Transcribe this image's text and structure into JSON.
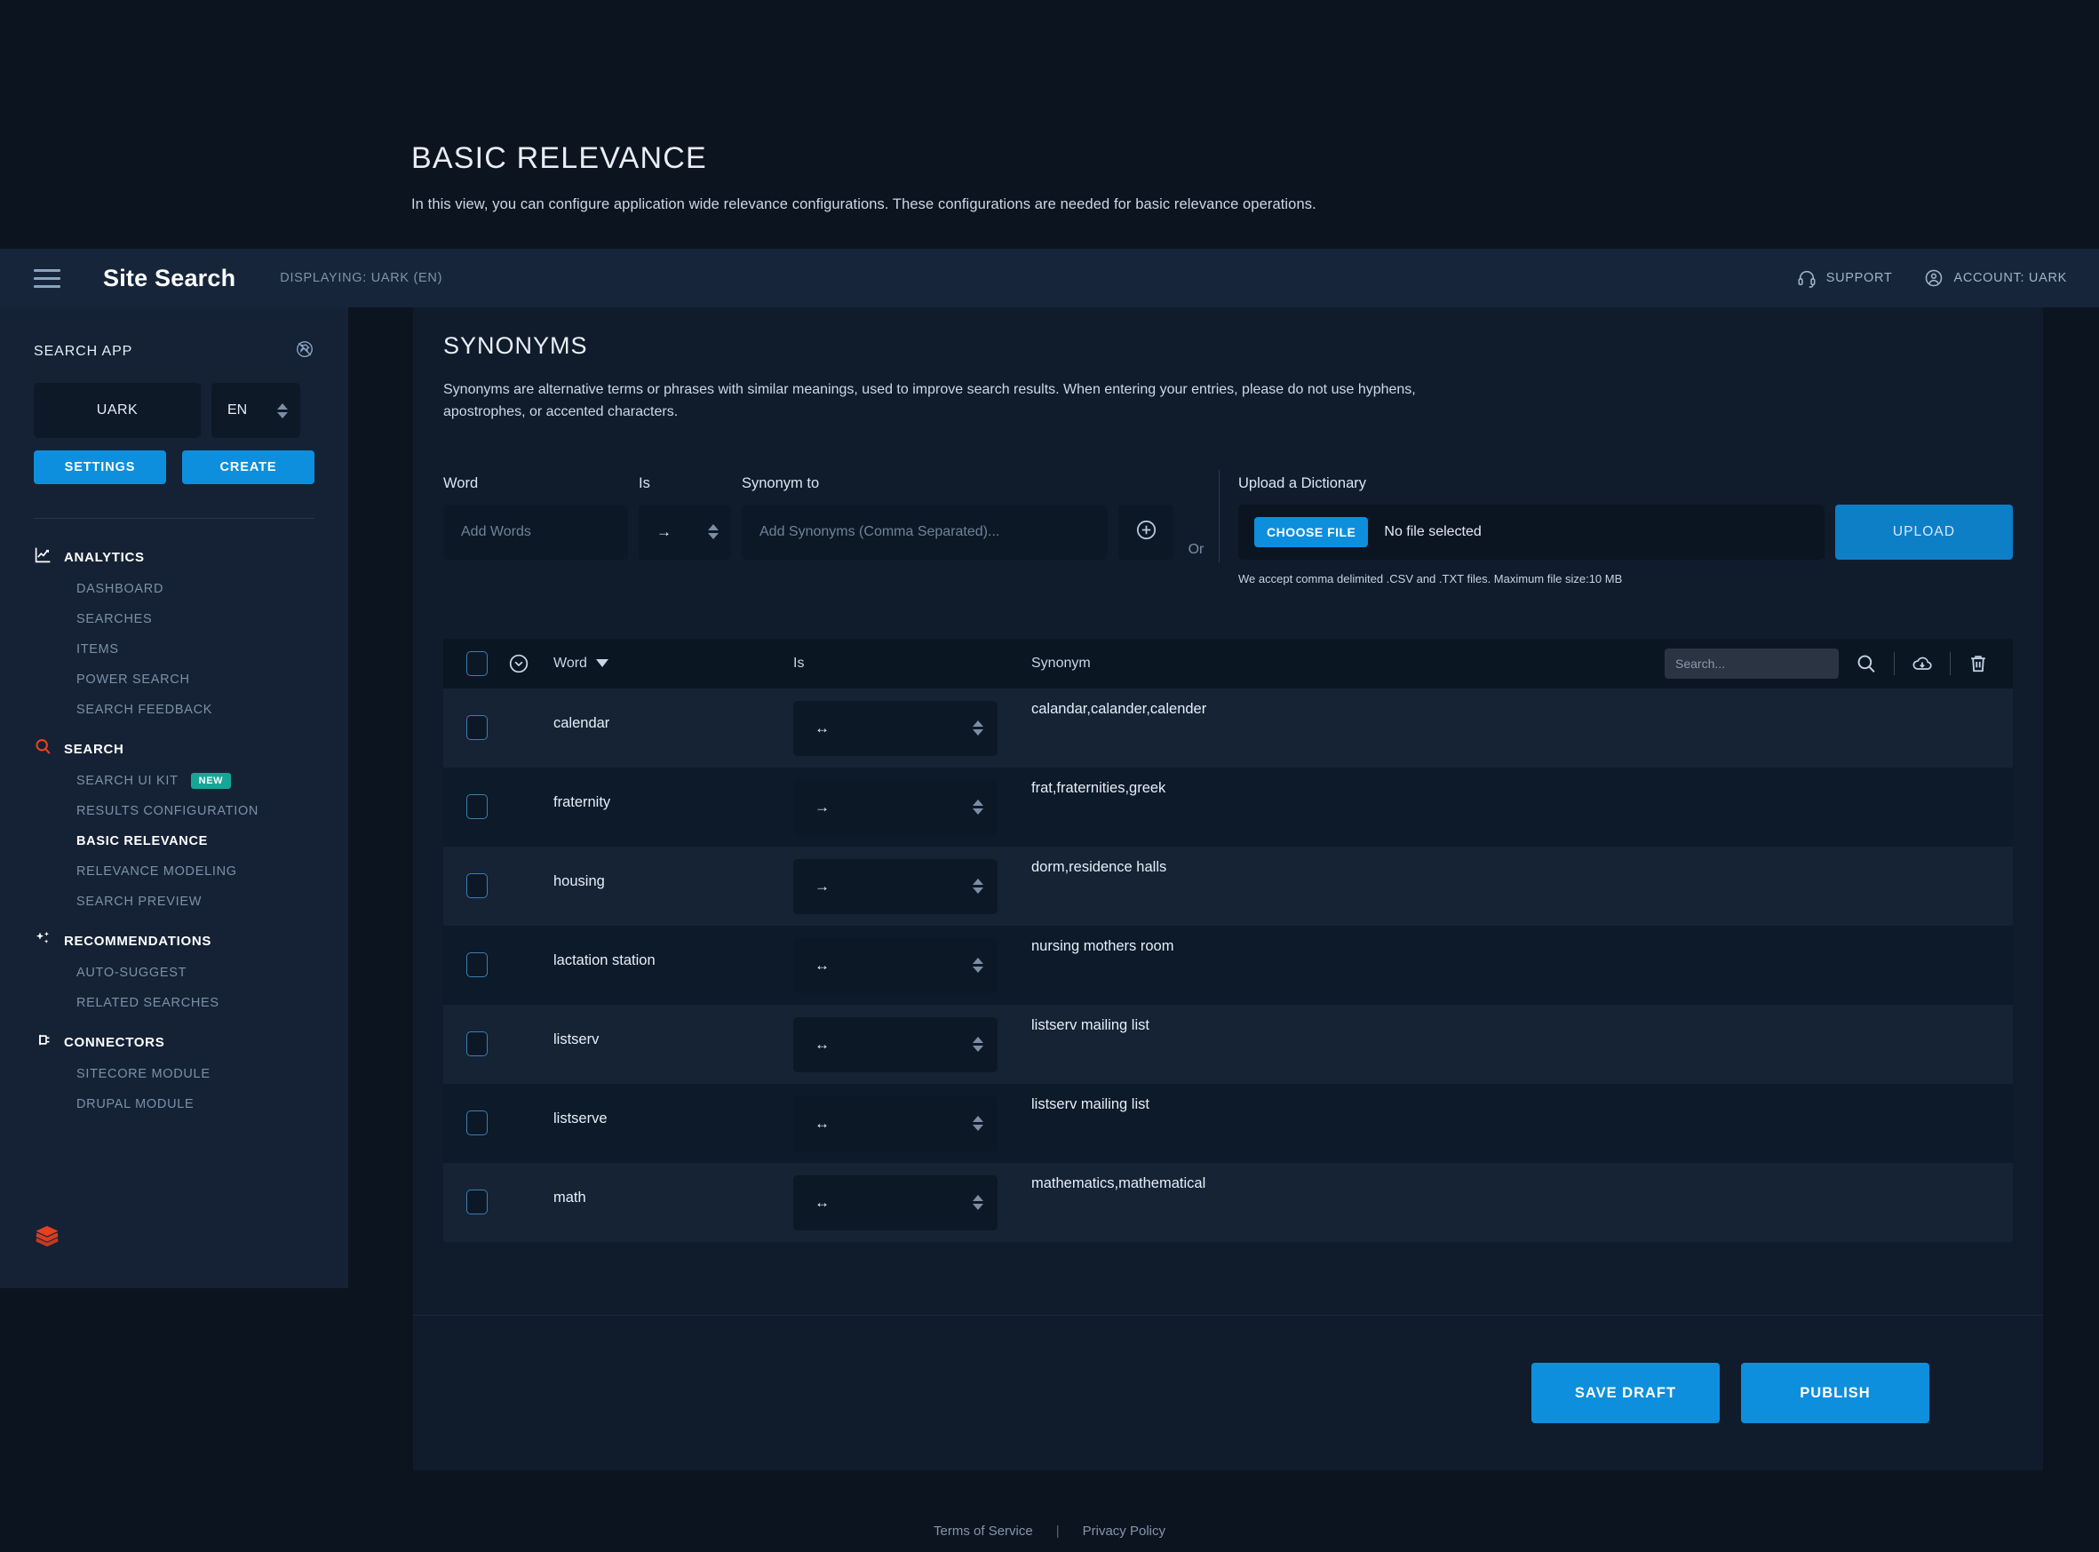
{
  "intro": {
    "title": "BASIC RELEVANCE",
    "description": "In this view, you can configure application wide relevance configurations. These configurations are needed for basic relevance operations."
  },
  "topbar": {
    "brand": "Site Search",
    "displaying": "DISPLAYING: UARK (EN)",
    "support_label": "SUPPORT",
    "account_label": "ACCOUNT: UARK"
  },
  "sidebar": {
    "section_title": "SEARCH APP",
    "app_value": "UARK",
    "lang_value": "EN",
    "settings_label": "SETTINGS",
    "create_label": "CREATE",
    "groups": [
      {
        "label": "ANALYTICS",
        "icon": "chart-line-icon",
        "items": [
          {
            "label": "DASHBOARD",
            "active": false,
            "badge": ""
          },
          {
            "label": "SEARCHES",
            "active": false,
            "badge": ""
          },
          {
            "label": "ITEMS",
            "active": false,
            "badge": ""
          },
          {
            "label": "POWER SEARCH",
            "active": false,
            "badge": ""
          },
          {
            "label": "SEARCH FEEDBACK",
            "active": false,
            "badge": ""
          }
        ]
      },
      {
        "label": "SEARCH",
        "icon": "search-icon",
        "items": [
          {
            "label": "SEARCH UI KIT",
            "active": false,
            "badge": "NEW"
          },
          {
            "label": "RESULTS CONFIGURATION",
            "active": false,
            "badge": ""
          },
          {
            "label": "BASIC RELEVANCE",
            "active": true,
            "badge": ""
          },
          {
            "label": "RELEVANCE MODELING",
            "active": false,
            "badge": ""
          },
          {
            "label": "SEARCH PREVIEW",
            "active": false,
            "badge": ""
          }
        ]
      },
      {
        "label": "RECOMMENDATIONS",
        "icon": "sparkle-icon",
        "items": [
          {
            "label": "AUTO-SUGGEST",
            "active": false,
            "badge": ""
          },
          {
            "label": "RELATED SEARCHES",
            "active": false,
            "badge": ""
          }
        ]
      },
      {
        "label": "CONNECTORS",
        "icon": "plug-icon",
        "items": [
          {
            "label": "SITECORE MODULE",
            "active": false,
            "badge": ""
          },
          {
            "label": "DRUPAL MODULE",
            "active": false,
            "badge": ""
          }
        ]
      }
    ]
  },
  "section": {
    "title": "SYNONYMS",
    "description": "Synonyms are alternative terms or phrases with similar meanings, used to improve search results. When entering your entries, please do not use hyphens, apostrophes, or accented characters."
  },
  "form": {
    "word_label": "Word",
    "is_label": "Is",
    "synonym_label": "Synonym to",
    "word_placeholder": "Add Words",
    "synonym_placeholder": "Add Synonyms (Comma Separated)...",
    "direction_value": "→",
    "add_icon": "plus-circle-icon",
    "or_label": "Or"
  },
  "upload": {
    "title": "Upload a Dictionary",
    "choose_file_label": "CHOOSE FILE",
    "no_file_label": "No file selected",
    "upload_label": "UPLOAD",
    "note": "We accept comma delimited .CSV and .TXT files. Maximum file size:10 MB"
  },
  "table": {
    "columns": {
      "word": "Word",
      "is": "Is",
      "synonym": "Synonym"
    },
    "search_placeholder": "Search...",
    "rows": [
      {
        "word": "calendar",
        "direction": "↔",
        "synonym": "calandar,calander,calender"
      },
      {
        "word": "fraternity",
        "direction": "→",
        "synonym": "frat,fraternities,greek"
      },
      {
        "word": "housing",
        "direction": "→",
        "synonym": "dorm,residence halls"
      },
      {
        "word": "lactation station",
        "direction": "↔",
        "synonym": "nursing mothers room"
      },
      {
        "word": "listserv",
        "direction": "↔",
        "synonym": "listserv mailing list"
      },
      {
        "word": "listserve",
        "direction": "↔",
        "synonym": "listserv mailing list"
      },
      {
        "word": "math",
        "direction": "↔",
        "synonym": "mathematics,mathematical"
      }
    ]
  },
  "actions": {
    "save_draft_label": "SAVE DRAFT",
    "publish_label": "PUBLISH"
  },
  "footer": {
    "terms_label": "Terms of Service",
    "separator": "|",
    "privacy_label": "Privacy Policy"
  },
  "colors": {
    "accent": "#0d8fdd",
    "badge_new": "#16a697",
    "logo": "#e8401f",
    "search_icon": "#e8401f"
  }
}
